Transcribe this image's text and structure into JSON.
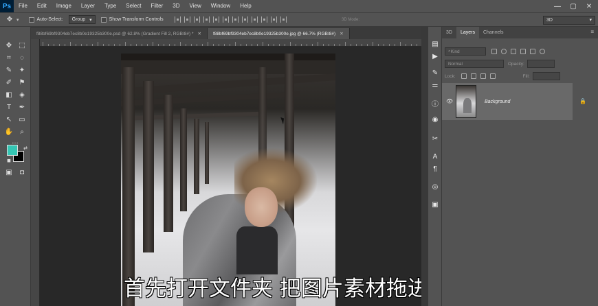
{
  "app": {
    "logo": "Ps"
  },
  "menu": [
    "File",
    "Edit",
    "Image",
    "Layer",
    "Type",
    "Select",
    "Filter",
    "3D",
    "View",
    "Window",
    "Help"
  ],
  "window_controls": {
    "minimize": "—",
    "maximize": "▢",
    "close": "✕"
  },
  "options": {
    "auto_select_label": "Auto-Select:",
    "auto_select_value": "Group",
    "transform_label": "Show Transform Controls",
    "mode_3d_label": "3D Mode:",
    "workspace_value": "3D"
  },
  "tabs": [
    {
      "label": "f88bf69bf9304eb7ec8b0e19325b300e.psd @ 62.8% (Gradient Fill 2, RGB/8#) *",
      "close": "✕",
      "active": false
    },
    {
      "label": "f88bf69bf9304eb7ec8b0e19325b300e.jpg @ 66.7% (RGB/8#)",
      "close": "✕",
      "active": true
    }
  ],
  "subtitle": "首先打开文件夹 把图片素材拖进ps",
  "colors": {
    "foreground": "#35c6b4",
    "background": "#000000"
  },
  "icons": {
    "move": "✥",
    "marquee": "⬚",
    "lasso": "◌",
    "magic_wand": "✦",
    "crop": "⌗",
    "eyedropper": "✎",
    "healing": "✚",
    "brush": "✐",
    "stamp": "⚑",
    "history": "↺",
    "eraser": "◧",
    "bucket": "◈",
    "blur": "◔",
    "dodge": "◑",
    "pen": "✒",
    "type": "T",
    "path_select": "↖",
    "shape": "▭",
    "hand": "✋",
    "zoom": "⌕",
    "more": "…",
    "swap": "⇄",
    "quickmask": "◘",
    "screen": "▣"
  },
  "panel": {
    "tabs": [
      "3D",
      "Layers",
      "Channels"
    ],
    "active_tab": "Layers",
    "menu": "≡",
    "filter_label": "Kind",
    "blend_mode": "Normal",
    "opacity_label": "Opacity:",
    "lock_label": "Lock:",
    "fill_label": "Fill:",
    "layers": [
      {
        "name": "Background",
        "visible": true,
        "locked": true
      }
    ]
  },
  "side_icons": [
    "layers-icon",
    "play-icon",
    "brush-settings-icon",
    "adjust-icon",
    "info-icon",
    "properties-icon",
    "tools-icon",
    "character-icon",
    "paragraph-icon",
    "libraries-icon",
    "adjustments-icon"
  ]
}
